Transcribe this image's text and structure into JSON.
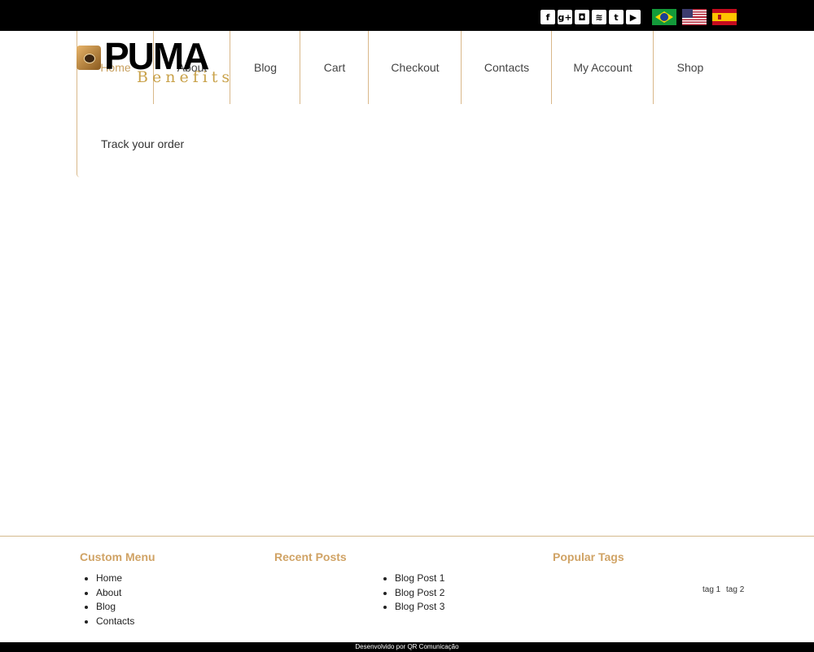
{
  "social_icons": [
    {
      "name": "facebook-icon",
      "glyph": "f"
    },
    {
      "name": "google-plus-icon",
      "glyph": "g+"
    },
    {
      "name": "instagram-icon",
      "glyph": "◘"
    },
    {
      "name": "rss-icon",
      "glyph": "≋"
    },
    {
      "name": "twitter-icon",
      "glyph": "t"
    },
    {
      "name": "youtube-icon",
      "glyph": "▶"
    }
  ],
  "languages": [
    "brazil-flag-icon",
    "usa-flag-icon",
    "spain-flag-icon"
  ],
  "logo": {
    "word": "PUMA",
    "sub": "Benefits"
  },
  "nav": {
    "items": [
      "Home",
      "About",
      "Blog",
      "Cart",
      "Checkout",
      "Contacts",
      "My Account",
      "Shop"
    ],
    "active": "Home"
  },
  "content": {
    "track_order": "Track your order"
  },
  "footer": {
    "custom_menu": {
      "title": "Custom Menu",
      "items": [
        "Home",
        "About",
        "Blog",
        "Contacts"
      ]
    },
    "recent_posts": {
      "title": "Recent Posts",
      "items": [
        "Blog Post 1",
        "Blog Post 2",
        "Blog Post 3"
      ]
    },
    "popular_tags": {
      "title": "Popular Tags",
      "items": [
        "tag 1",
        "tag 2"
      ]
    },
    "credit": "Desenvolvido por QR Comunicação"
  },
  "colors": {
    "accent": "#d0a365",
    "topbar": "#000000",
    "border": "#d9b88a"
  }
}
